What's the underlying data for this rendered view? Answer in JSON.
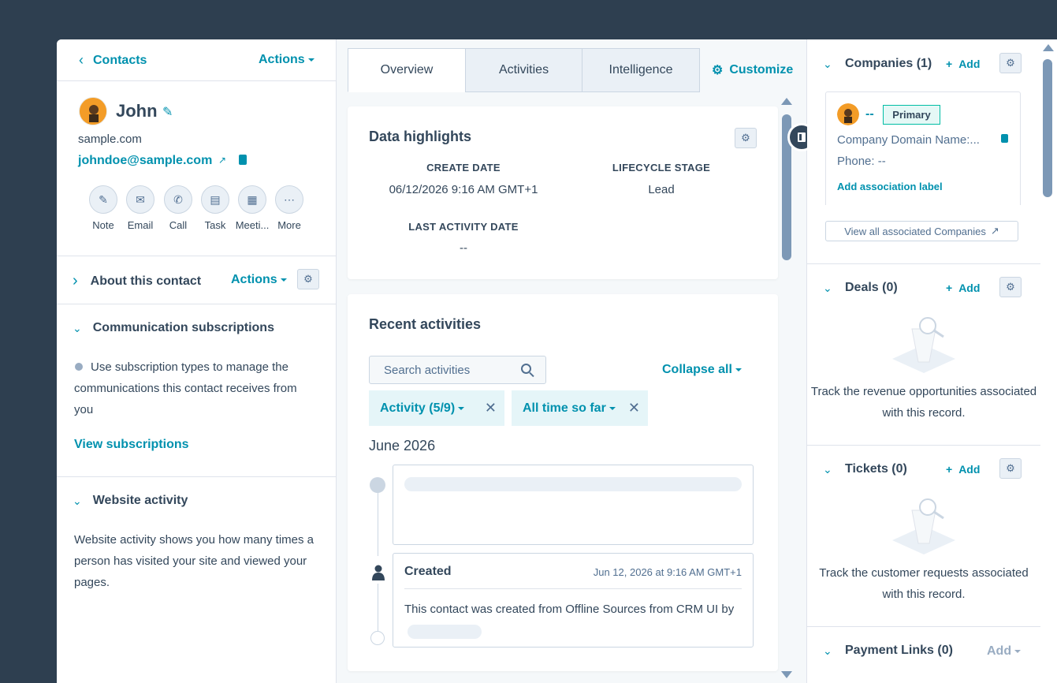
{
  "left": {
    "back_label": "Contacts",
    "actions_label": "Actions",
    "contact_name": "John",
    "domain": "sample.com",
    "email": "johndoe@sample.com",
    "quick_actions": [
      {
        "label": "Note",
        "icon": "note-icon"
      },
      {
        "label": "Email",
        "icon": "email-icon"
      },
      {
        "label": "Call",
        "icon": "call-icon"
      },
      {
        "label": "Task",
        "icon": "task-icon"
      },
      {
        "label": "Meeti...",
        "icon": "meeting-icon"
      },
      {
        "label": "More",
        "icon": "more-icon"
      }
    ],
    "about": {
      "title": "About this contact",
      "actions_label": "Actions"
    },
    "subscriptions": {
      "title": "Communication subscriptions",
      "text": "Use subscription types to manage the communications this contact receives from you",
      "link": "View subscriptions"
    },
    "website": {
      "title": "Website activity",
      "text": "Website activity shows you how many times a person has visited your site and viewed your pages."
    }
  },
  "tabs": {
    "overview": "Overview",
    "activities": "Activities",
    "intelligence": "Intelligence",
    "customize": "Customize"
  },
  "highlights": {
    "title": "Data highlights",
    "create_date_label": "CREATE DATE",
    "create_date_value": "06/12/2026 9:16 AM GMT+1",
    "lifecycle_label": "LIFECYCLE STAGE",
    "lifecycle_value": "Lead",
    "last_activity_label": "LAST ACTIVITY DATE",
    "last_activity_value": "--"
  },
  "recent": {
    "title": "Recent activities",
    "search_placeholder": "Search activities",
    "collapse_label": "Collapse all",
    "filter_activity": "Activity (5/9)",
    "filter_time": "All time so far",
    "month": "June 2026",
    "created_title": "Created",
    "created_time": "Jun 12, 2026 at 9:16 AM GMT+1",
    "created_text": "This contact was created from Offline Sources from CRM UI by"
  },
  "right": {
    "companies": {
      "title": "Companies (1)",
      "add": "Add",
      "company_name": "--",
      "primary_badge": "Primary",
      "domain_label": "Company Domain Name:...",
      "phone_label": "Phone: --",
      "assoc_label": "Add association label",
      "view_all": "View all associated Companies"
    },
    "deals": {
      "title": "Deals (0)",
      "add": "Add",
      "empty": "Track the revenue opportunities associated with this record."
    },
    "tickets": {
      "title": "Tickets (0)",
      "add": "Add",
      "empty": "Track the customer requests associated with this record."
    },
    "payment": {
      "title": "Payment Links (0)",
      "add": "Add"
    }
  },
  "colors": {
    "accent": "#0091ae",
    "bg": "#2e3f50",
    "text": "#33475b"
  }
}
